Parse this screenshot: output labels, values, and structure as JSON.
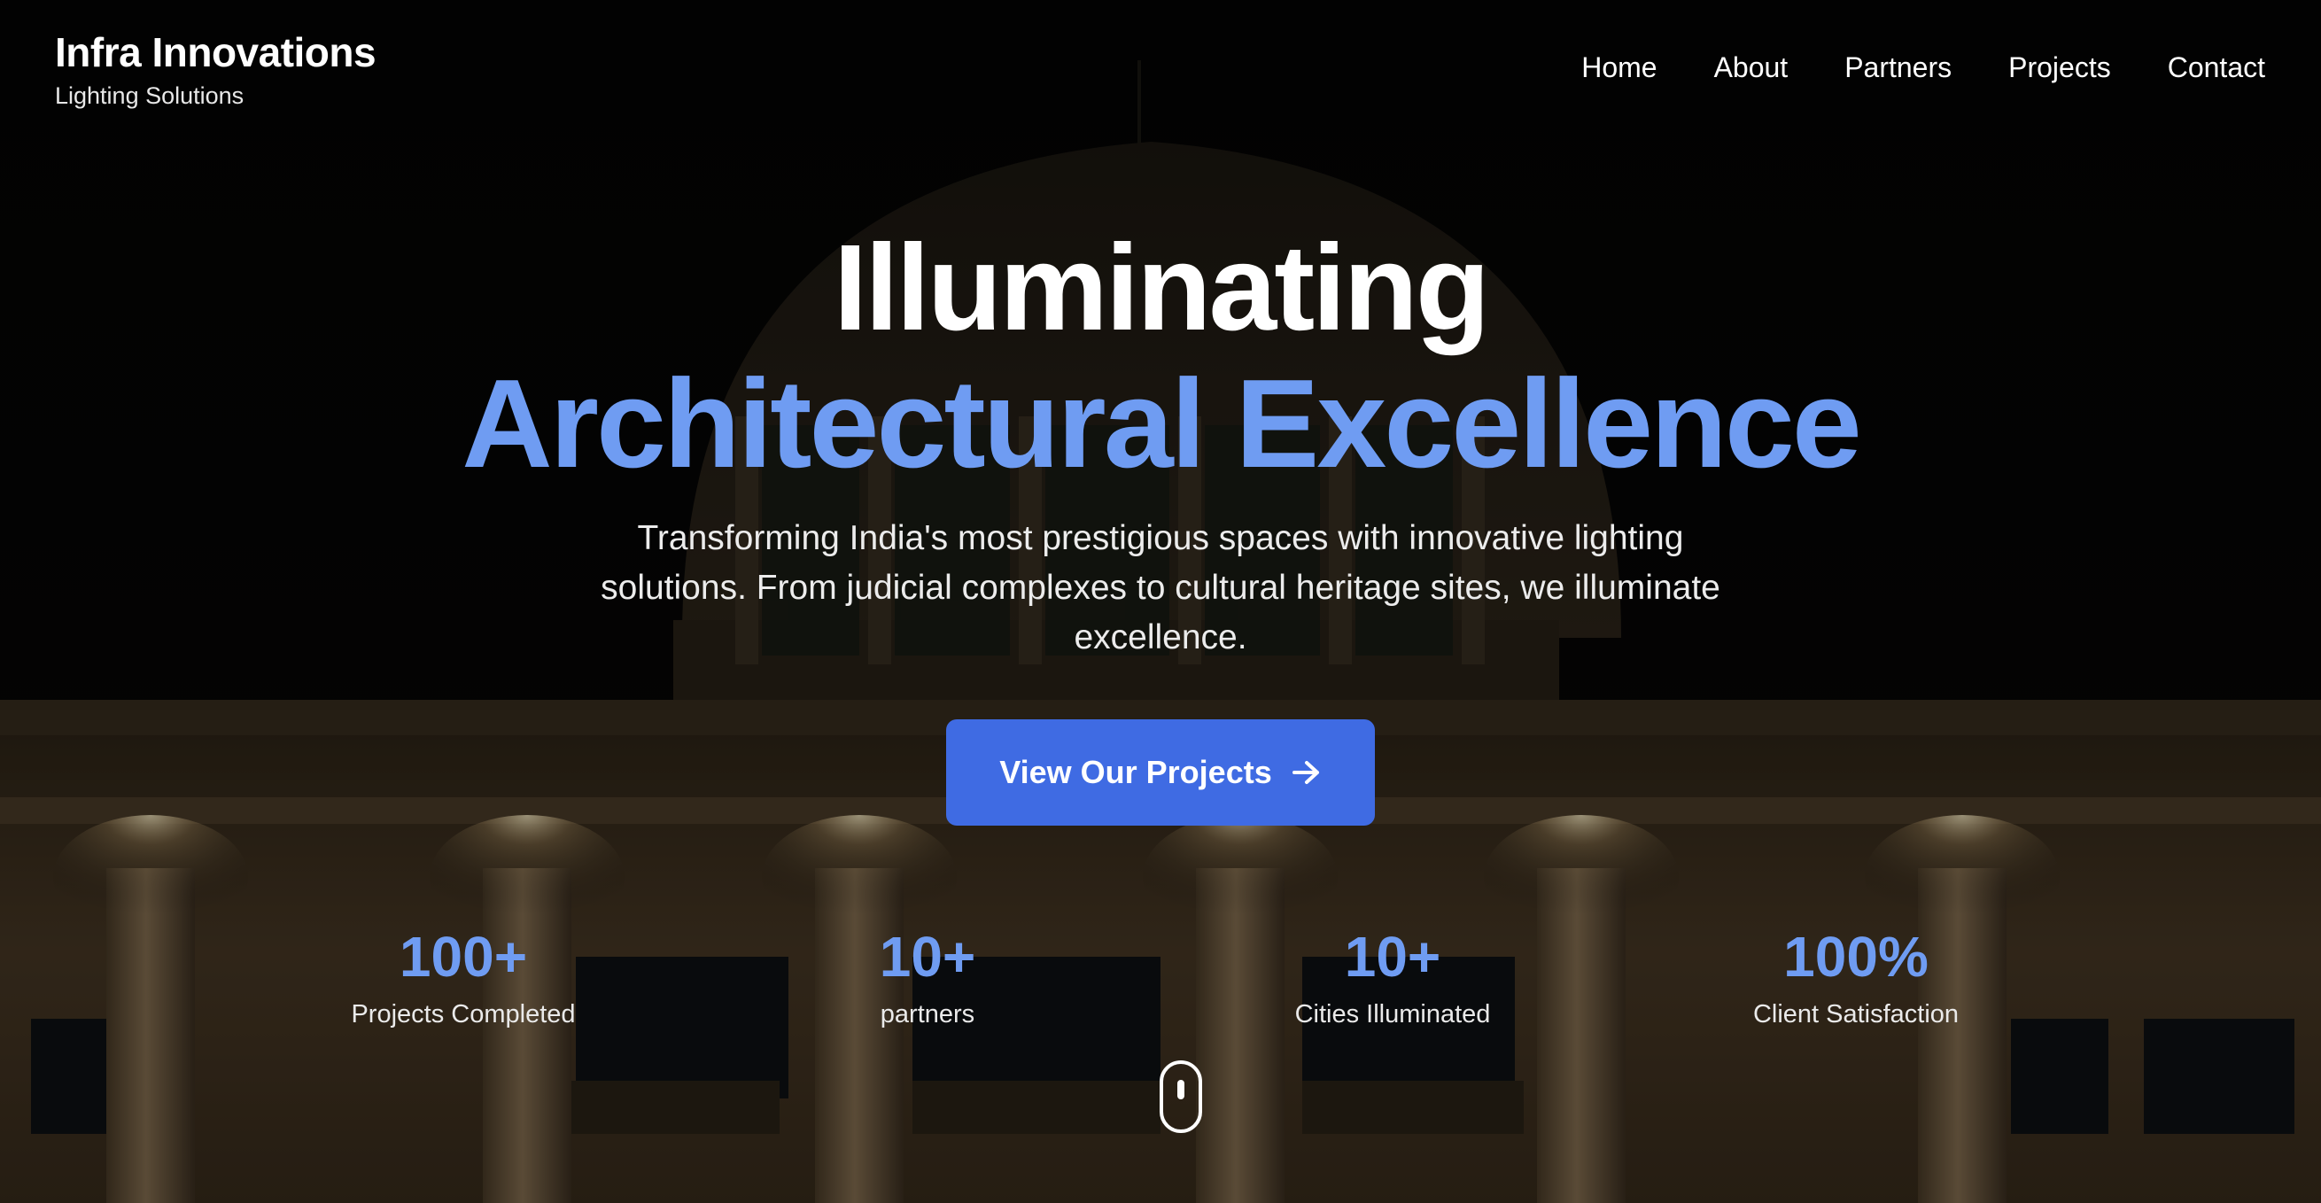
{
  "brand": {
    "title": "Infra Innovations",
    "subtitle": "Lighting Solutions"
  },
  "nav": {
    "items": [
      "Home",
      "About",
      "Partners",
      "Projects",
      "Contact"
    ]
  },
  "hero": {
    "headline_line1": "Illuminating",
    "headline_line2": "Architectural Excellence",
    "description": "Transforming India's most prestigious spaces with innovative lighting solutions. From judicial complexes to cultural heritage sites, we illuminate excellence.",
    "cta_label": "View Our Projects",
    "cta_icon": "arrow-right-icon",
    "background": "night-lit-domed-courthouse-building"
  },
  "stats": [
    {
      "value": "100+",
      "label": "Projects Completed"
    },
    {
      "value": "10+",
      "label": "partners"
    },
    {
      "value": "10+",
      "label": "Cities Illuminated"
    },
    {
      "value": "100%",
      "label": "Client Satisfaction"
    }
  ],
  "scroll_indicator_icon": "mouse-scroll-icon",
  "colors": {
    "accent": "#6f9cf2",
    "button": "#3f6be3",
    "text": "#ffffff"
  }
}
